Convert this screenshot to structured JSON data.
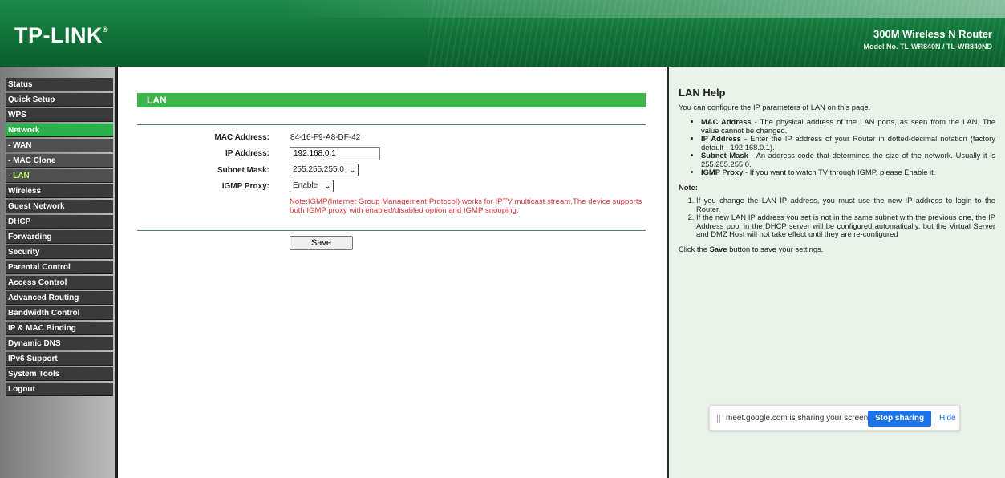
{
  "header": {
    "logo": "TP-LINK",
    "logo_mark": "®",
    "product_name": "300M Wireless N Router",
    "model": "Model No. TL-WR840N / TL-WR840ND"
  },
  "sidebar": {
    "items": [
      {
        "label": "Status",
        "state": "normal"
      },
      {
        "label": "Quick Setup",
        "state": "normal"
      },
      {
        "label": "WPS",
        "state": "normal"
      },
      {
        "label": "Network",
        "state": "active"
      },
      {
        "label": "- WAN",
        "state": "sub"
      },
      {
        "label": "- MAC Clone",
        "state": "sub"
      },
      {
        "label": "- LAN",
        "state": "current"
      },
      {
        "label": "Wireless",
        "state": "normal"
      },
      {
        "label": "Guest Network",
        "state": "normal"
      },
      {
        "label": "DHCP",
        "state": "normal"
      },
      {
        "label": "Forwarding",
        "state": "normal"
      },
      {
        "label": "Security",
        "state": "normal"
      },
      {
        "label": "Parental Control",
        "state": "normal"
      },
      {
        "label": "Access Control",
        "state": "normal"
      },
      {
        "label": "Advanced Routing",
        "state": "normal"
      },
      {
        "label": "Bandwidth Control",
        "state": "normal"
      },
      {
        "label": "IP & MAC Binding",
        "state": "normal"
      },
      {
        "label": "Dynamic DNS",
        "state": "normal"
      },
      {
        "label": "IPv6 Support",
        "state": "normal"
      },
      {
        "label": "System Tools",
        "state": "normal"
      },
      {
        "label": "Logout",
        "state": "normal"
      }
    ]
  },
  "main": {
    "section_title": "LAN",
    "mac_label": "MAC Address:",
    "mac_value": "84-16-F9-A8-DF-42",
    "ip_label": "IP Address:",
    "ip_value": "192.168.0.1",
    "subnet_label": "Subnet Mask:",
    "subnet_value": "255.255.255.0",
    "igmp_label": "IGMP Proxy:",
    "igmp_value": "Enable",
    "igmp_note": "Note:IGMP(Internet Group Management Protocol) works for IPTV multicast stream.The device supports both IGMP proxy with enabled/disabled option and IGMP snooping.",
    "save_label": "Save"
  },
  "help": {
    "title": "LAN Help",
    "intro": "You can configure the IP parameters of LAN on this page.",
    "bullets": [
      {
        "term": "MAC Address",
        "text": " - The physical address of the LAN ports, as seen from the LAN. The value cannot be changed."
      },
      {
        "term": "IP Address",
        "text": " - Enter the IP address of your Router in dotted-decimal notation (factory default - 192.168.0.1)."
      },
      {
        "term": "Subnet Mask",
        "text": " - An address code that determines the size of the network. Usually it is 255.255.255.0."
      },
      {
        "term": "IGMP Proxy",
        "text": " - If you want to watch TV through IGMP, please Enable it."
      }
    ],
    "note_heading": "Note:",
    "notes": [
      "If you change the LAN IP address, you must use the new IP address to login to the Router.",
      "If the new LAN IP address you set is not in the same subnet with the previous one, the IP Address pool in the DHCP server will be configured automatically, but the Virtual Server and DMZ Host will not take effect until they are re-configured"
    ],
    "footer_pre": "Click the ",
    "footer_bold": "Save",
    "footer_post": " button to save your settings."
  },
  "share_bar": {
    "grip": "||",
    "message": "meet.google.com is sharing your screen.",
    "stop_label": "Stop sharing",
    "hide_label": "Hide"
  },
  "colors": {
    "header_green": "#0f6f36",
    "menu_active": "#2bb14a",
    "section_bar": "#3cb54a",
    "help_bg": "#e9f3ea",
    "note_red": "#dd3333",
    "stop_blue": "#1a73e8"
  }
}
